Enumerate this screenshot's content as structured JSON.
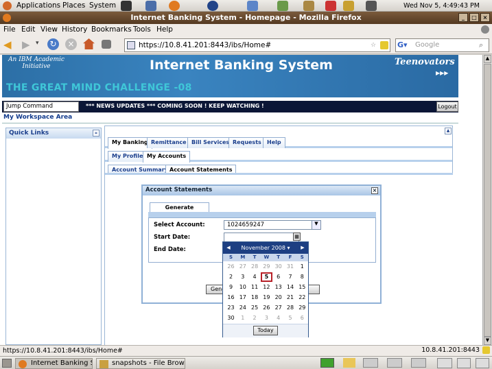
{
  "gnome": {
    "menu_applications": "Applications",
    "menu_places": "Places",
    "menu_system": "System",
    "clock": "Wed Nov  5,  4:49:43 PM"
  },
  "firefox": {
    "window_title": "Internet Banking System - Homepage - Mozilla Firefox",
    "menu": [
      "File",
      "Edit",
      "View",
      "History",
      "Bookmarks",
      "Tools",
      "Help"
    ],
    "url": "https://10.8.41.201:8443/ibs/Home#",
    "search_placeholder": "Google",
    "status_left": "https://10.8.41.201:8443/ibs/Home#",
    "status_right": "10.8.41.201:8443"
  },
  "banner": {
    "ibm_line": "An IBM Academic Initiative",
    "title": "Internet Banking System",
    "challenge": "THE GREAT MIND CHALLENGE -08",
    "team": "Teenovators",
    "team_arrows": "▶▶▶"
  },
  "toolbar": {
    "jump_value": "Jump Command",
    "news": "*** NEWS UPDATES *** COMING SOON ! KEEP WATCHING !",
    "logout": "Logout"
  },
  "workspace_title": "My Workspace Area",
  "quick_links": {
    "title": "Quick Links",
    "collapse": "«"
  },
  "tabs_main": [
    "My Banking",
    "Remittance",
    "Bill Services",
    "Requests",
    "Help"
  ],
  "tabs_sub": [
    "My Profile",
    "My Accounts"
  ],
  "tabs_sub2": [
    "Account Summary",
    "Account Statements"
  ],
  "dialog": {
    "title": "Account Statements",
    "tab": "Generate Statement",
    "select_account_label": "Select Account:",
    "select_account_value": "1024659247",
    "start_date_label": "Start Date:",
    "end_date_label": "End Date:",
    "generate_button_partial": "Gene"
  },
  "calendar": {
    "month_label": "November 2008 ▾",
    "weekdays": [
      "S",
      "M",
      "T",
      "W",
      "T",
      "F",
      "S"
    ],
    "weeks": [
      [
        [
          "26",
          1
        ],
        [
          "27",
          1
        ],
        [
          "28",
          1
        ],
        [
          "29",
          1
        ],
        [
          "30",
          1
        ],
        [
          "31",
          1
        ],
        [
          "1",
          0
        ]
      ],
      [
        [
          "2",
          0
        ],
        [
          "3",
          0
        ],
        [
          "4",
          0
        ],
        [
          "5",
          2
        ],
        [
          "6",
          0
        ],
        [
          "7",
          0
        ],
        [
          "8",
          0
        ]
      ],
      [
        [
          "9",
          0
        ],
        [
          "10",
          0
        ],
        [
          "11",
          0
        ],
        [
          "12",
          0
        ],
        [
          "13",
          0
        ],
        [
          "14",
          0
        ],
        [
          "15",
          0
        ]
      ],
      [
        [
          "16",
          0
        ],
        [
          "17",
          0
        ],
        [
          "18",
          0
        ],
        [
          "19",
          0
        ],
        [
          "20",
          0
        ],
        [
          "21",
          0
        ],
        [
          "22",
          0
        ]
      ],
      [
        [
          "23",
          0
        ],
        [
          "24",
          0
        ],
        [
          "25",
          0
        ],
        [
          "26",
          0
        ],
        [
          "27",
          0
        ],
        [
          "28",
          0
        ],
        [
          "29",
          0
        ]
      ],
      [
        [
          "30",
          0
        ],
        [
          "1",
          1
        ],
        [
          "2",
          1
        ],
        [
          "3",
          1
        ],
        [
          "4",
          1
        ],
        [
          "5",
          1
        ],
        [
          "6",
          1
        ]
      ]
    ],
    "today_button": "Today"
  },
  "taskbar": {
    "task1": "Internet Banking Sys...",
    "task2": "snapshots - File Brow..."
  }
}
